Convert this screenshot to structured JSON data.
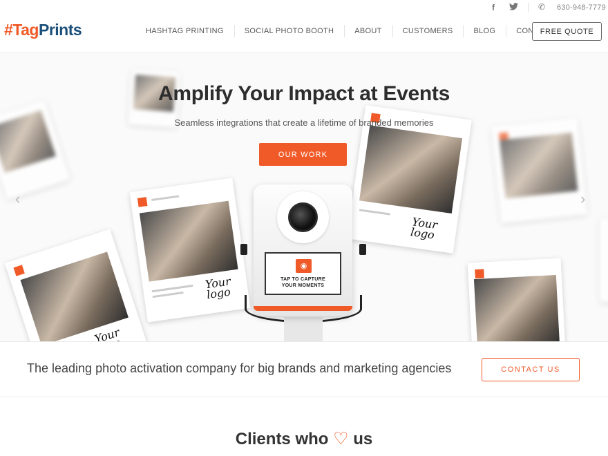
{
  "header": {
    "logo": {
      "hash": "#",
      "tag": "Tag",
      "prints": "Prints"
    },
    "social": {
      "facebook_icon": "facebook-icon",
      "twitter_icon": "twitter-icon"
    },
    "phone": "630-948-7779",
    "nav": [
      "HASHTAG PRINTING",
      "SOCIAL PHOTO BOOTH",
      "ABOUT",
      "CUSTOMERS",
      "BLOG",
      "CONTACT"
    ],
    "cta": "FREE QUOTE"
  },
  "hero": {
    "title": "Amplify Your Impact at Events",
    "subtitle": "Seamless integrations that create a lifetime of branded memories",
    "button": "OUR WORK",
    "card_script": "Your logo",
    "booth": {
      "tap_text_line1": "TAP TO CAPTURE",
      "tap_text_line2": "YOUR MOMENTS"
    },
    "arrows": {
      "left": "‹",
      "right": "›"
    }
  },
  "tagline": {
    "text": "The leading photo activation company for big brands and marketing agencies",
    "button": "CONTACT US"
  },
  "clients": {
    "prefix": "Clients who",
    "heart": "♡",
    "suffix": "us"
  },
  "colors": {
    "accent": "#f05a28",
    "brand_blue": "#1b4f79"
  }
}
